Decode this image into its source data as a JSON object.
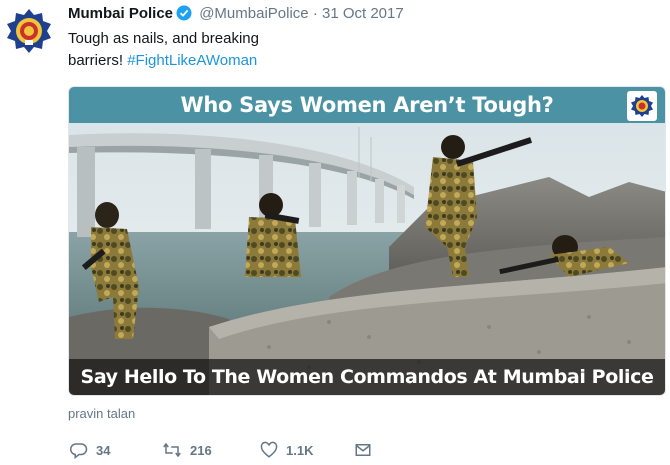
{
  "tweet": {
    "author_name": "Mumbai Police",
    "handle": "@MumbaiPolice",
    "separator": "·",
    "date": "31 Oct 2017",
    "text_line1": "Tough as nails, and breaking",
    "text_line2": "barriers!",
    "hashtag": "#FightLikeAWoman",
    "verified_icon": "verified-badge-icon",
    "accent_color": "#1b95e0"
  },
  "media": {
    "top_caption": "Who Says Women Aren’t Tough?",
    "bottom_caption": "Say Hello To The Women Commandos At Mumbai Police",
    "photo_credit": "pravin talan"
  },
  "actions": {
    "reply_count": "34",
    "retweet_count": "216",
    "like_count": "1.1K",
    "reply_icon": "reply-icon",
    "retweet_icon": "retweet-icon",
    "like_icon": "heart-icon",
    "dm_icon": "envelope-icon"
  }
}
